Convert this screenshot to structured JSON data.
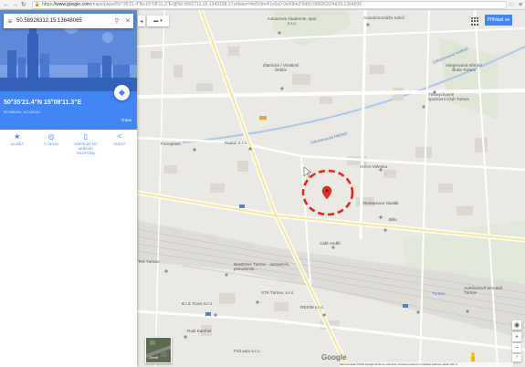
{
  "browser": {
    "url_scheme": "https",
    "url_host": "://www.google.com",
    "url_path": "/maps/place/50°35'21.4\"N+15°08'11.3\"E/@50.5892711,15.1343108,17z/data=!4m5!3m4!1s0x0:0x0!8m2!3d50.5892631!4d15.1364806"
  },
  "search": {
    "value": "50.58926312,15.13648065"
  },
  "place": {
    "coords": "50°35'21.4\"N 15°08'11.3\"E",
    "sub": "50.589263, 15.136481",
    "route_label": "Trasa"
  },
  "actions": [
    {
      "label": "ULOŽIT",
      "icon": "star-icon"
    },
    {
      "label": "V OKOLÍ",
      "icon": "nearby-icon"
    },
    {
      "label": "ODESLAT DO VAŠEHO TELEFONU",
      "icon": "phone-icon"
    },
    {
      "label": "SDÍLET",
      "icon": "share-icon"
    }
  ],
  "topbar": {
    "signin": "Přihlásit se"
  },
  "map_labels": [
    "Autodemontáže Kalců",
    "Autoservis Akademie, spol. s.r.o.",
    "Zlatnicko / Vlastimil Šebíle",
    "Integrovaná střední škola Turnov",
    "Tělovýchovné sportovní Club Turnov",
    "Fornaplast",
    "Radač S.r.o.",
    "AHHA Velenka",
    "Restaurace Skalák",
    "Billa",
    "Café Anděl",
    "TeK Turnov",
    "BestDrive Turnov - autoservis, pneuservis...",
    "STK Turnov, s.r.o.",
    "B.r.d. Kovo S.r.o.",
    "RESIM s.r.o.",
    "Turnov",
    "Autobusové terminál Turnov",
    "Rudi Karcher",
    "Fritt auto s.r.o."
  ],
  "streets": [
    "Odbočenecká Nábřeží",
    "Odbočenecká Nábřeží"
  ],
  "thumbnail_label": "Země",
  "logo": "Google",
  "footer": "Mapová data ©2016 Google   Smluvní podmínky   Ochrana soukromí   Odeslat zpětnou vazbu   200 m",
  "colors": {
    "accent": "#4285f4",
    "marker": "#d93025",
    "highlight_circle": "#e2271b"
  }
}
